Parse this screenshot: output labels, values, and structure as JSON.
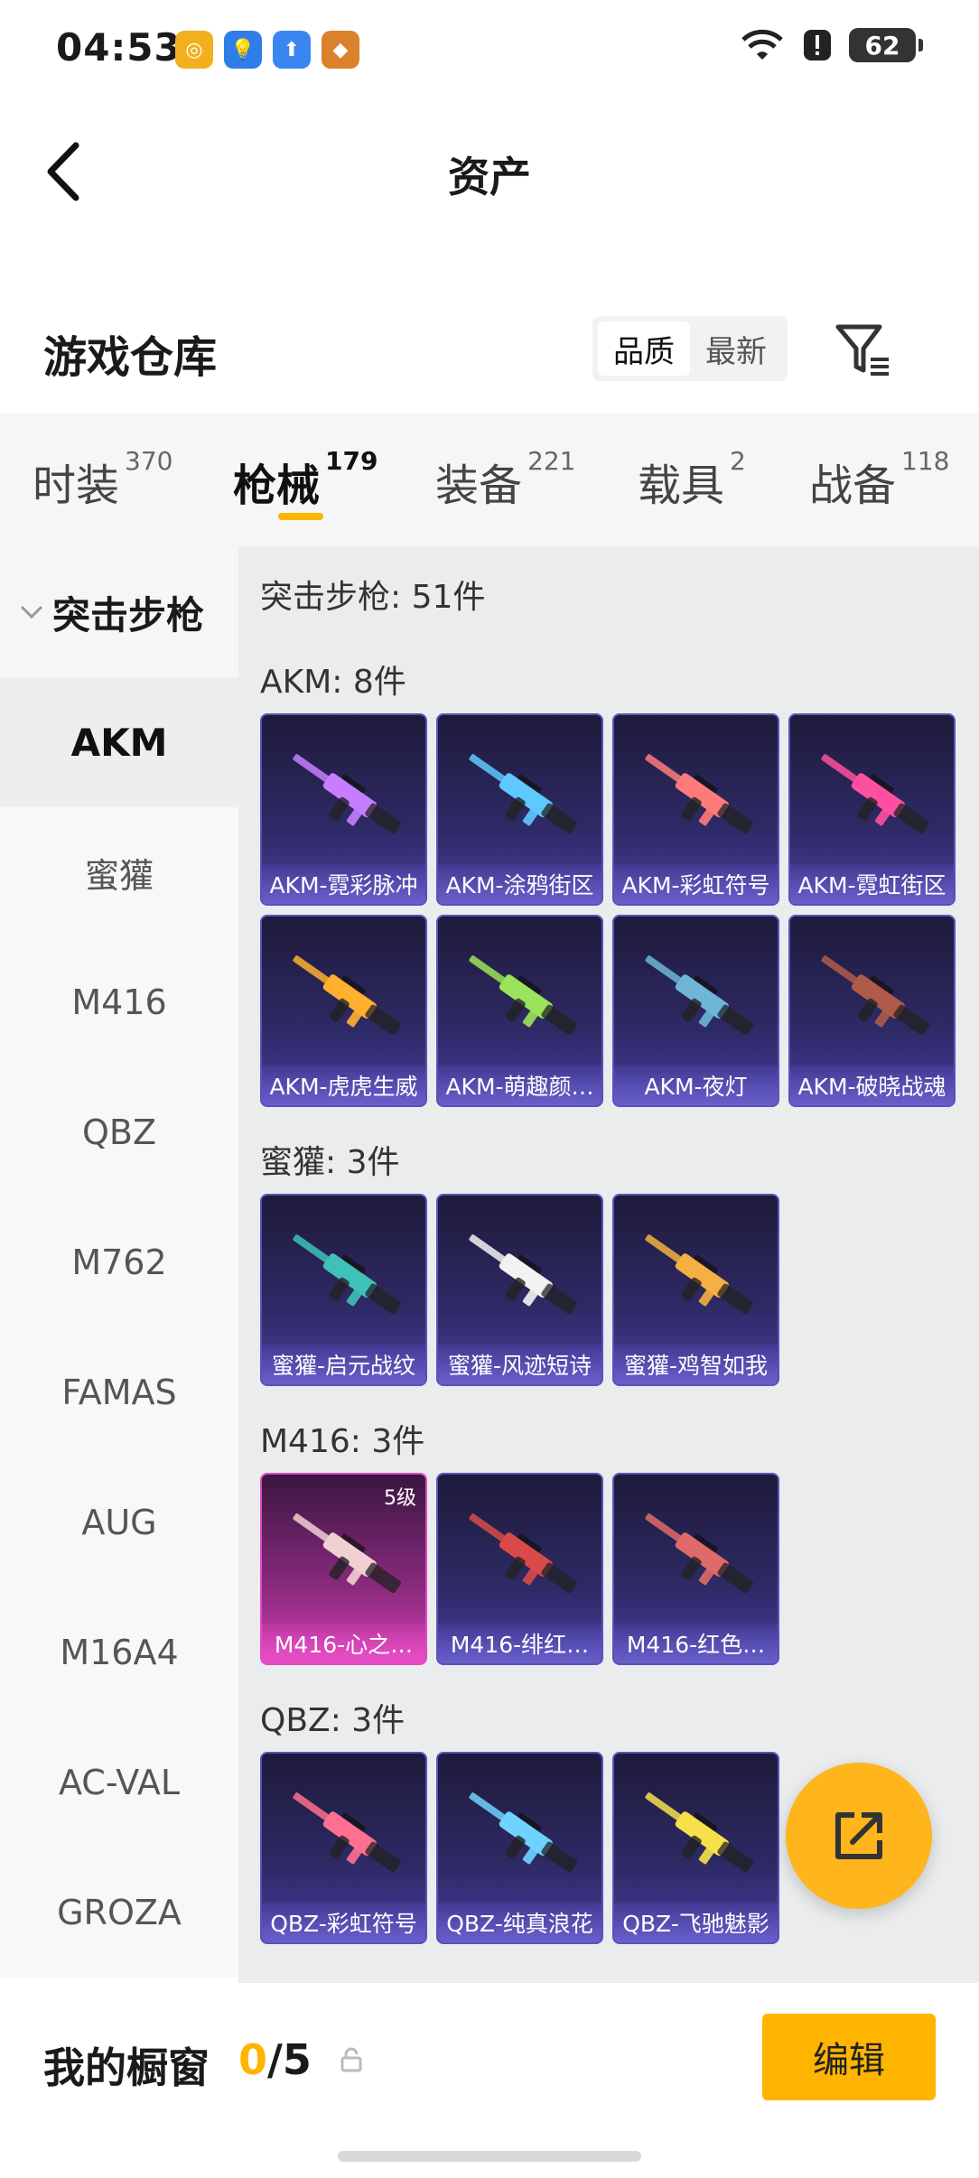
{
  "status": {
    "time": "04:53",
    "battery": "62",
    "app_icons": [
      {
        "name": "app-icon-1",
        "color": "#f2b01e"
      },
      {
        "name": "app-icon-2",
        "color": "#2f7de8"
      },
      {
        "name": "app-icon-3",
        "color": "#3a86f0"
      },
      {
        "name": "app-icon-4",
        "color": "#d9822b"
      }
    ]
  },
  "header": {
    "title": "资产"
  },
  "warehouse": {
    "title": "游戏仓库",
    "sort_options": [
      "品质",
      "最新"
    ]
  },
  "tabs": [
    {
      "label": "时装",
      "count": "370"
    },
    {
      "label": "枪械",
      "count": "179"
    },
    {
      "label": "装备",
      "count": "221"
    },
    {
      "label": "载具",
      "count": "2"
    },
    {
      "label": "战备",
      "count": "118"
    }
  ],
  "sidebar": {
    "category": "突击步枪",
    "items": [
      "AKM",
      "蜜獾",
      "M416",
      "QBZ",
      "M762",
      "FAMAS",
      "AUG",
      "M16A4",
      "AC-VAL",
      "GROZA"
    ]
  },
  "content": {
    "total": "突击步枪: 51件",
    "sections": [
      {
        "title": "AKM: 8件",
        "items": [
          {
            "label": "AKM-霓彩脉冲",
            "accent": "#c77dff"
          },
          {
            "label": "AKM-涂鸦街区",
            "accent": "#5ec8ff"
          },
          {
            "label": "AKM-彩虹符号",
            "accent": "#ff7a7a"
          },
          {
            "label": "AKM-霓虹街区",
            "accent": "#ff4fa0"
          },
          {
            "label": "AKM-虎虎生威",
            "accent": "#ffb02e"
          },
          {
            "label": "AKM-萌趣颜…",
            "accent": "#9be35a"
          },
          {
            "label": "AKM-夜灯",
            "accent": "#6fb6d6"
          },
          {
            "label": "AKM-破晓战魂",
            "accent": "#b05a4a"
          }
        ]
      },
      {
        "title": "蜜獾: 3件",
        "items": [
          {
            "label": "蜜獾-启元战纹",
            "accent": "#3fc1b8"
          },
          {
            "label": "蜜獾-风迹短诗",
            "accent": "#f2f2f2"
          },
          {
            "label": "蜜獾-鸡智如我",
            "accent": "#f5b041"
          }
        ]
      },
      {
        "title": "M416: 3件",
        "items": [
          {
            "label": "M416-心之…",
            "accent": "#f0d0d0",
            "level": "5级",
            "style": "pink"
          },
          {
            "label": "M416-绯红…",
            "accent": "#d94a4a"
          },
          {
            "label": "M416-红色…",
            "accent": "#e06a6a"
          }
        ]
      },
      {
        "title": "QBZ: 3件",
        "items": [
          {
            "label": "QBZ-彩虹符号",
            "accent": "#ff6f91"
          },
          {
            "label": "QBZ-纯真浪花",
            "accent": "#6fd3ff"
          },
          {
            "label": "QBZ-飞驰魅影",
            "accent": "#f7e14a"
          }
        ]
      }
    ]
  },
  "bottom": {
    "title": "我的橱窗",
    "count_current": "0",
    "count_total": "/5",
    "edit_label": "编辑"
  }
}
